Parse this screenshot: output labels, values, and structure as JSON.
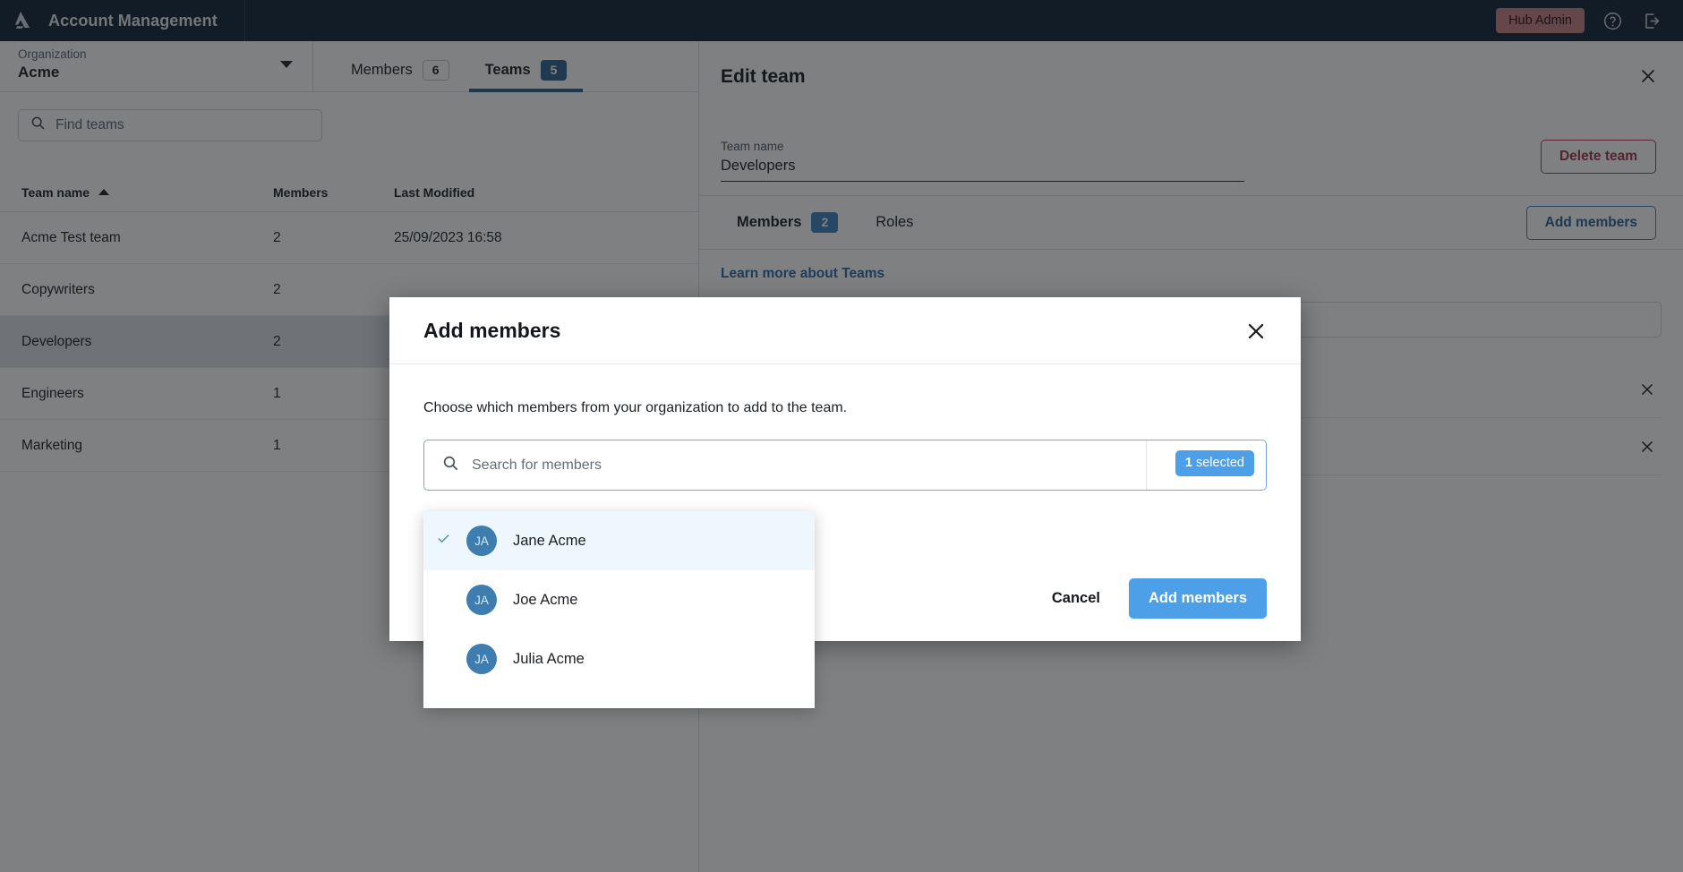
{
  "topbar": {
    "logo_icon": "brand-triangle-logo",
    "title": "Account Management",
    "hub_admin_label": "Hub Admin",
    "help_icon": "help-circle-icon",
    "logout_icon": "logout-icon"
  },
  "org": {
    "label": "Organization",
    "value": "Acme",
    "caret_icon": "chevron-down-icon"
  },
  "main_tabs": [
    {
      "label": "Members",
      "count": "6",
      "active": false
    },
    {
      "label": "Teams",
      "count": "5",
      "active": true
    }
  ],
  "search": {
    "icon": "search-icon",
    "placeholder": "Find teams",
    "value": ""
  },
  "table": {
    "columns": [
      "Team name",
      "Members",
      "Last Modified"
    ],
    "sort_column": "Team name",
    "sort_icon": "sort-ascending-caret-icon",
    "rows": [
      {
        "name": "Acme Test team",
        "members": "2",
        "modified": "25/09/2023 16:58",
        "selected": false
      },
      {
        "name": "Copywriters",
        "members": "2",
        "modified": "",
        "selected": false
      },
      {
        "name": "Developers",
        "members": "2",
        "modified": "",
        "selected": true
      },
      {
        "name": "Engineers",
        "members": "1",
        "modified": "",
        "selected": false
      },
      {
        "name": "Marketing",
        "members": "1",
        "modified": "",
        "selected": false
      }
    ]
  },
  "edit_panel": {
    "title": "Edit team",
    "close_icon": "close-icon",
    "team_name_label": "Team name",
    "team_name_value": "Developers",
    "delete_label": "Delete team",
    "tabs": [
      {
        "label": "Members",
        "count": "2",
        "active": true
      },
      {
        "label": "Roles",
        "count": "",
        "active": false
      }
    ],
    "add_members_label": "Add members",
    "learn_link": "Learn more about Teams",
    "member_search_placeholder": "",
    "member_rows": [
      {
        "remove_icon": "close-icon"
      },
      {
        "remove_icon": "close-icon"
      }
    ]
  },
  "modal": {
    "title": "Add members",
    "close_icon": "close-icon",
    "description": "Choose which members from your organization to add to the team.",
    "search_icon": "search-icon",
    "search_placeholder": "Search for members",
    "search_value": "",
    "selected_count": "1",
    "selected_suffix": "selected",
    "cancel_label": "Cancel",
    "submit_label": "Add members"
  },
  "dropdown": {
    "items": [
      {
        "initials": "JA",
        "name": "Jane Acme",
        "checked": true,
        "check_icon": "check-icon"
      },
      {
        "initials": "JA",
        "name": "Joe Acme",
        "checked": false,
        "check_icon": ""
      },
      {
        "initials": "JA",
        "name": "Julia Acme",
        "checked": false,
        "check_icon": ""
      }
    ]
  },
  "colors": {
    "topbar_bg": "#112233",
    "accent_blue": "#4da0e8",
    "tab_underline": "#2b5d85",
    "badge_blue": "#2b6291",
    "danger": "#a33348",
    "hub_admin_bg": "#c98080",
    "avatar_bg": "#3d7db0"
  }
}
